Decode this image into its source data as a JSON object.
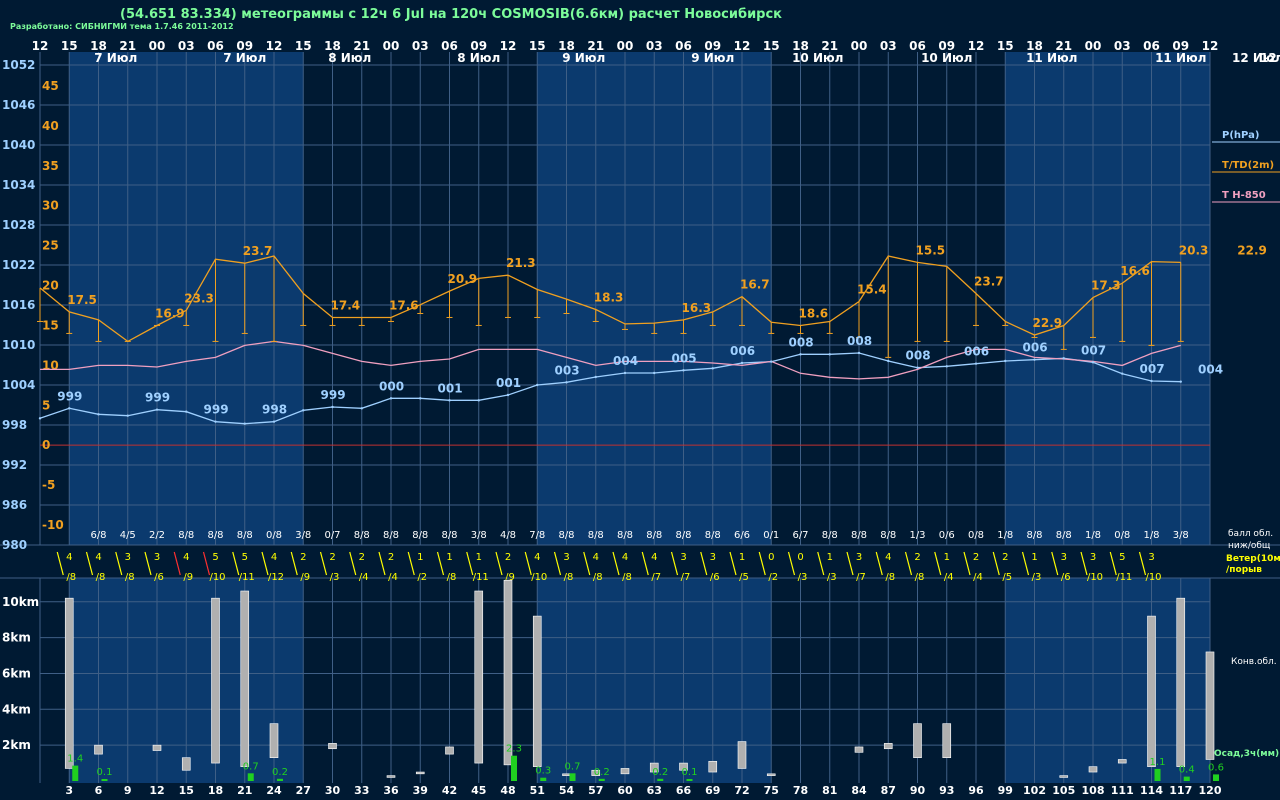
{
  "header": {
    "title": "(54.651 83.334) метеограммы с  12ч 6 Jul на 120ч COSMOSIB(6.6км) расчет Новосибирск",
    "credit": "Разработано: СИБНИГМИ тема 1.7.46 2011-2012"
  },
  "colors": {
    "bg": "#001a33",
    "band": "#0b3a6e",
    "grid": "#3f5f86",
    "pressure": "#9fd0ff",
    "temp": "#f0a020",
    "t850": "#f0a0c0",
    "wind": "#ffff00",
    "windRed": "#ff3030",
    "precip": "#20d020",
    "cloud": "#b0b0b0",
    "text": "#ffffff",
    "yellowText": "#ffff00",
    "greenText": "#7CFC9A"
  },
  "chart_data": {
    "type": "line",
    "top_hours": [
      "12",
      "15",
      "18",
      "21",
      "00",
      "03",
      "06",
      "09",
      "12",
      "15",
      "18",
      "21",
      "00",
      "03",
      "06",
      "09",
      "12",
      "15",
      "18",
      "21",
      "00",
      "03",
      "06",
      "09",
      "12",
      "15",
      "18",
      "21",
      "00",
      "03",
      "06",
      "09",
      "12",
      "15",
      "18",
      "21",
      "00",
      "03",
      "06",
      "09",
      "12"
    ],
    "date_labels": [
      "7 Июл",
      "7 Июл",
      "8 Июл",
      "8 Июл",
      "9 Июл",
      "9 Июл",
      "10 Июл",
      "10 Июл",
      "11 Июл",
      "11 Июл",
      "12 Июл"
    ],
    "pressure_axis": {
      "ticks": [
        "1052",
        "1046",
        "1040",
        "1034",
        "1028",
        "1022",
        "1016",
        "1010",
        "1004",
        "998",
        "992",
        "986",
        "980"
      ]
    },
    "temp_axis": {
      "ticks": [
        "45",
        "40",
        "35",
        "30",
        "25",
        "20",
        "15",
        "10",
        "5",
        "0",
        "-5",
        "-10"
      ]
    },
    "legend": [
      {
        "label": "P(hPa)",
        "color": "#9fd0ff"
      },
      {
        "label": "T/TD(2m)",
        "color": "#f0a020"
      },
      {
        "label": "T H-850",
        "color": "#f0a0c0"
      }
    ],
    "temperature": [
      19.7,
      16.7,
      15.7,
      13.0,
      15.0,
      16.9,
      23.3,
      22.8,
      23.7,
      19.0,
      16.0,
      16.0,
      16.0,
      17.6,
      19.3,
      20.9,
      21.3,
      19.5,
      18.3,
      17.0,
      15.2,
      15.3,
      15.7,
      16.7,
      18.6,
      15.4,
      15.0,
      15.5,
      18.0,
      23.7,
      22.9,
      22.4,
      19.0,
      15.5,
      13.8,
      15.0,
      18.5,
      20.3,
      23.0,
      22.9
    ],
    "temp_min_bars": [
      15.5,
      14.0,
      13.0,
      13.0,
      15.0,
      15.0,
      13.0,
      14.0,
      13.0,
      15.0,
      15.0,
      15.0,
      15.5,
      16.5,
      16.0,
      15.0,
      16.0,
      16.0,
      16.5,
      15.5,
      14.5,
      14.0,
      14.0,
      15.0,
      15.0,
      14.0,
      14.0,
      14.0,
      13.5,
      11.0,
      13.0,
      13.0,
      15.0,
      15.0,
      13.5,
      12.0,
      13.5,
      13.0,
      12.5,
      13.0
    ],
    "pressure": [
      999.0,
      1000.5,
      999.6,
      999.4,
      1000.3,
      1000.0,
      998.5,
      998.2,
      998.5,
      1000.2,
      1000.7,
      1000.5,
      1002.0,
      1002.0,
      1001.7,
      1001.7,
      1002.5,
      1004.0,
      1004.4,
      1005.2,
      1005.8,
      1005.8,
      1006.2,
      1006.5,
      1007.3,
      1007.5,
      1008.6,
      1008.6,
      1008.8,
      1007.6,
      1006.6,
      1006.8,
      1007.2,
      1007.6,
      1007.8,
      1008.0,
      1007.4,
      1005.7,
      1004.6,
      1004.5
    ],
    "pressure_labels": [
      {
        "t": 3,
        "v": "999"
      },
      {
        "t": 12,
        "v": "999"
      },
      {
        "t": 18,
        "v": "999"
      },
      {
        "t": 24,
        "v": "998"
      },
      {
        "t": 30,
        "v": "999"
      },
      {
        "t": 36,
        "v": "000"
      },
      {
        "t": 42,
        "v": "001"
      },
      {
        "t": 48,
        "v": "001"
      },
      {
        "t": 54,
        "v": "003"
      },
      {
        "t": 60,
        "v": "004"
      },
      {
        "t": 66,
        "v": "005"
      },
      {
        "t": 72,
        "v": "006"
      },
      {
        "t": 78,
        "v": "008"
      },
      {
        "t": 84,
        "v": "008"
      },
      {
        "t": 90,
        "v": "008"
      },
      {
        "t": 96,
        "v": "006"
      },
      {
        "t": 102,
        "v": "006"
      },
      {
        "t": 108,
        "v": "007"
      },
      {
        "t": 114,
        "v": "007"
      },
      {
        "t": 120,
        "v": "004"
      }
    ],
    "t850": [
      9.5,
      9.5,
      10.0,
      10.0,
      9.8,
      10.5,
      11.0,
      12.5,
      13.0,
      12.5,
      11.5,
      10.5,
      10.0,
      10.5,
      10.8,
      12.0,
      12.0,
      12.0,
      11.0,
      10.0,
      10.5,
      10.5,
      10.5,
      10.3,
      10.0,
      10.5,
      9.0,
      8.5,
      8.3,
      8.5,
      9.5,
      11.0,
      12.0,
      12.0,
      11.0,
      10.8,
      10.5,
      10.0,
      11.5,
      12.5
    ],
    "temp_labels": [
      {
        "t": 9,
        "v": "17.5"
      },
      {
        "t": 18,
        "v": "16.9"
      },
      {
        "t": 21,
        "v": "23.3"
      },
      {
        "t": 27,
        "v": "23.7"
      },
      {
        "t": 36,
        "v": "17.4"
      },
      {
        "t": 42,
        "v": "17.6"
      },
      {
        "t": 48,
        "v": "20.9"
      },
      {
        "t": 54,
        "v": "21.3"
      },
      {
        "t": 63,
        "v": "18.3"
      },
      {
        "t": 72,
        "v": "16.3"
      },
      {
        "t": 78,
        "v": "16.7"
      },
      {
        "t": 84,
        "v": "18.6"
      },
      {
        "t": 90,
        "v": "15.4"
      },
      {
        "t": 96,
        "v": "15.5"
      },
      {
        "t": 102,
        "v": "23.7"
      },
      {
        "t": 108,
        "v": "22.9"
      },
      {
        "t": 114,
        "v": "17.3"
      },
      {
        "t": 117,
        "v": "16.6"
      },
      {
        "t": 123,
        "v": "20.3"
      },
      {
        "t": 129,
        "v": "22.9"
      }
    ],
    "cloud_cover": [
      "6/8",
      "4/5",
      "2/2",
      "8/8",
      "8/8",
      "8/8",
      "0/8",
      "3/8",
      "0/7",
      "8/8",
      "8/8",
      "8/8",
      "8/8",
      "3/8",
      "4/8",
      "7/8",
      "8/8",
      "8/8",
      "8/8",
      "8/8",
      "8/8",
      "8/8",
      "6/6",
      "0/1",
      "6/7",
      "8/8",
      "8/8",
      "8/8",
      "1/3",
      "0/6",
      "0/8",
      "1/8",
      "8/8",
      "8/8",
      "1/8",
      "0/8",
      "1/8",
      "3/8"
    ],
    "cloud_cover_label": "балл обл. ниж/общ",
    "wind_speed": [
      "4",
      "4",
      "3",
      "3",
      "4",
      "5",
      "5",
      "4",
      "2",
      "2",
      "2",
      "2",
      "1",
      "1",
      "1",
      "2",
      "4",
      "3",
      "4",
      "4",
      "4",
      "3",
      "3",
      "1",
      "0",
      "0",
      "1",
      "3",
      "4",
      "2",
      "1",
      "2",
      "2",
      "1",
      "3",
      "3",
      "5",
      "3"
    ],
    "wind_gust": [
      "/8",
      "/8",
      "/8",
      "/6",
      "/9",
      "/10",
      "/11",
      "/12",
      "/9",
      "/3",
      "/4",
      "/4",
      "/2",
      "/8",
      "/11",
      "/9",
      "/10",
      "/8",
      "/8",
      "/8",
      "/7",
      "/7",
      "/6",
      "/5",
      "/2",
      "/3",
      "/3",
      "/7",
      "/8",
      "/8",
      "/4",
      "/4",
      "/5",
      "/3",
      "/6",
      "/10",
      "/11",
      "/10"
    ],
    "wind_red_indices": [
      4,
      5
    ],
    "wind_label_1": "Ветер(10м)",
    "wind_label_2": "/порыв",
    "height_axis": {
      "ticks": [
        "10km",
        "8km",
        "6km",
        "4km",
        "2km"
      ]
    },
    "cloud_columns": [
      {
        "t": 3,
        "lo": 0.7,
        "hi": 10.2
      },
      {
        "t": 6,
        "lo": 1.5,
        "hi": 2.0
      },
      {
        "t": 12,
        "lo": 1.7,
        "hi": 2.0
      },
      {
        "t": 15,
        "lo": 0.6,
        "hi": 1.3
      },
      {
        "t": 18,
        "lo": 1.0,
        "hi": 10.2
      },
      {
        "t": 21,
        "lo": 0.8,
        "hi": 10.6
      },
      {
        "t": 24,
        "lo": 1.3,
        "hi": 3.2
      },
      {
        "t": 30,
        "lo": 1.8,
        "hi": 2.1
      },
      {
        "t": 36,
        "lo": 0.2,
        "hi": 0.3
      },
      {
        "t": 39,
        "lo": 0.4,
        "hi": 0.5
      },
      {
        "t": 42,
        "lo": 1.5,
        "hi": 1.9
      },
      {
        "t": 45,
        "lo": 1.0,
        "hi": 10.6
      },
      {
        "t": 48,
        "lo": 0.9,
        "hi": 11.2
      },
      {
        "t": 51,
        "lo": 0.8,
        "hi": 9.2
      },
      {
        "t": 54,
        "lo": 0.3,
        "hi": 0.4
      },
      {
        "t": 57,
        "lo": 0.3,
        "hi": 0.6
      },
      {
        "t": 60,
        "lo": 0.4,
        "hi": 0.7
      },
      {
        "t": 63,
        "lo": 0.5,
        "hi": 1.0
      },
      {
        "t": 66,
        "lo": 0.6,
        "hi": 1.0
      },
      {
        "t": 69,
        "lo": 0.5,
        "hi": 1.1
      },
      {
        "t": 72,
        "lo": 0.7,
        "hi": 2.2
      },
      {
        "t": 75,
        "lo": 0.3,
        "hi": 0.4
      },
      {
        "t": 84,
        "lo": 1.6,
        "hi": 1.9
      },
      {
        "t": 87,
        "lo": 1.8,
        "hi": 2.1
      },
      {
        "t": 90,
        "lo": 1.3,
        "hi": 3.2
      },
      {
        "t": 93,
        "lo": 1.3,
        "hi": 3.2
      },
      {
        "t": 105,
        "lo": 0.2,
        "hi": 0.3
      },
      {
        "t": 108,
        "lo": 0.5,
        "hi": 0.8
      },
      {
        "t": 111,
        "lo": 1.0,
        "hi": 1.2
      },
      {
        "t": 114,
        "lo": 0.8,
        "hi": 9.2
      },
      {
        "t": 117,
        "lo": 0.8,
        "hi": 10.2
      },
      {
        "t": 120,
        "lo": 1.2,
        "hi": 7.2
      }
    ],
    "precip": [
      {
        "t": 3,
        "v": 1.4,
        "label": "1.4"
      },
      {
        "t": 6,
        "v": 0.05,
        "label": "0.1"
      },
      {
        "t": 21,
        "v": 0.7,
        "label": "0.7"
      },
      {
        "t": 24,
        "v": 0.2,
        "label": "0.2"
      },
      {
        "t": 48,
        "v": 2.3,
        "label": "2.3"
      },
      {
        "t": 51,
        "v": 0.3,
        "label": "0.3"
      },
      {
        "t": 54,
        "v": 0.7,
        "label": "0.7"
      },
      {
        "t": 57,
        "v": 0.2,
        "label": "0.2"
      },
      {
        "t": 63,
        "v": 0.2,
        "label": "0.2"
      },
      {
        "t": 66,
        "v": 0.1,
        "label": "0.1"
      },
      {
        "t": 114,
        "v": 1.1,
        "label": "1.1"
      },
      {
        "t": 117,
        "v": 0.4,
        "label": "0.4"
      },
      {
        "t": 120,
        "v": 0.6,
        "label": "0.6"
      }
    ],
    "bottom_hours": [
      "3",
      "6",
      "9",
      "12",
      "15",
      "18",
      "21",
      "24",
      "27",
      "30",
      "33",
      "36",
      "39",
      "42",
      "45",
      "48",
      "51",
      "54",
      "57",
      "60",
      "63",
      "66",
      "69",
      "72",
      "75",
      "78",
      "81",
      "84",
      "87",
      "90",
      "93",
      "96",
      "99",
      "102",
      "105",
      "108",
      "111",
      "114",
      "117",
      "120"
    ],
    "conv_label": "Конв.обл.",
    "precip_label": "Осад,3ч(мм)"
  }
}
